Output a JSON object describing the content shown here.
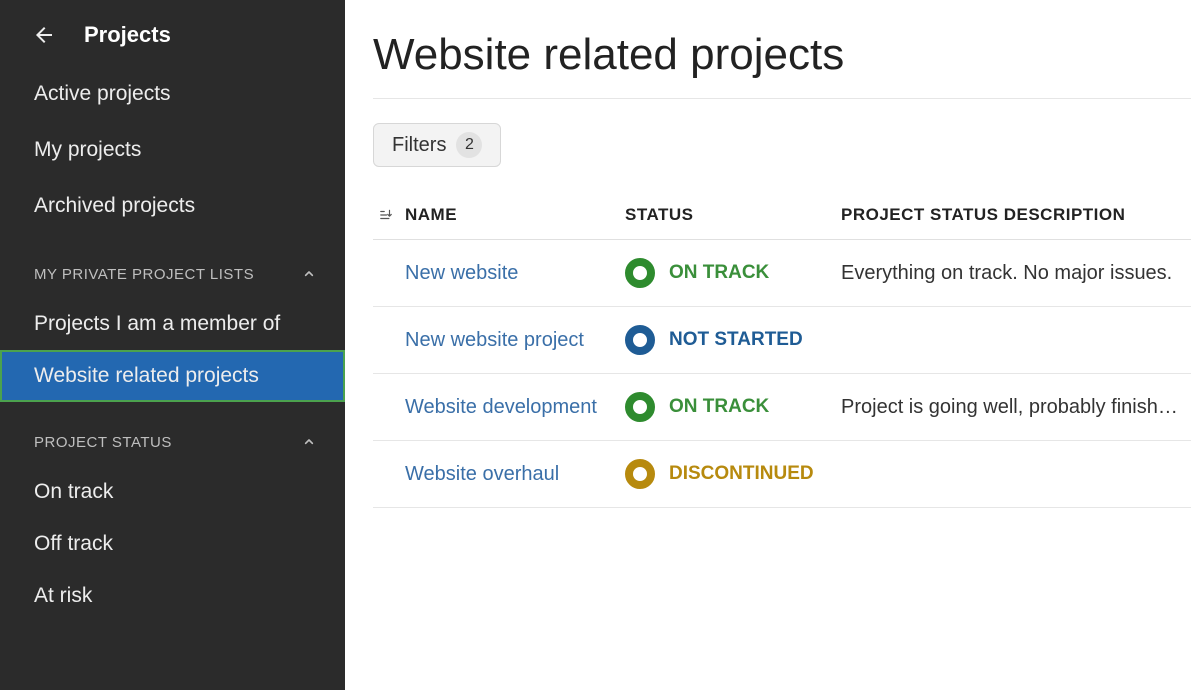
{
  "sidebar": {
    "title": "Projects",
    "nav": [
      {
        "label": "Active projects"
      },
      {
        "label": "My projects"
      },
      {
        "label": "Archived projects"
      }
    ],
    "sections": [
      {
        "header": "MY PRIVATE PROJECT LISTS",
        "items": [
          {
            "label": "Projects I am a member of",
            "active": false
          },
          {
            "label": "Website related projects",
            "active": true
          }
        ]
      },
      {
        "header": "PROJECT STATUS",
        "items": [
          {
            "label": "On track"
          },
          {
            "label": "Off track"
          },
          {
            "label": "At risk"
          }
        ]
      }
    ]
  },
  "main": {
    "title": "Website related projects",
    "filters": {
      "label": "Filters",
      "count": "2"
    },
    "table": {
      "columns": {
        "name": "NAME",
        "status": "STATUS",
        "desc": "PROJECT STATUS DESCRIPTION"
      },
      "rows": [
        {
          "name": "New website",
          "status": "ON TRACK",
          "status_color": "green",
          "desc": "Everything on track. No major issues."
        },
        {
          "name": "New website project",
          "status": "NOT STARTED",
          "status_color": "blue",
          "desc": ""
        },
        {
          "name": "Website development",
          "status": "ON TRACK",
          "status_color": "green",
          "desc": "Project is going well, probably finish…"
        },
        {
          "name": "Website overhaul",
          "status": "DISCONTINUED",
          "status_color": "gold",
          "desc": ""
        }
      ]
    }
  }
}
